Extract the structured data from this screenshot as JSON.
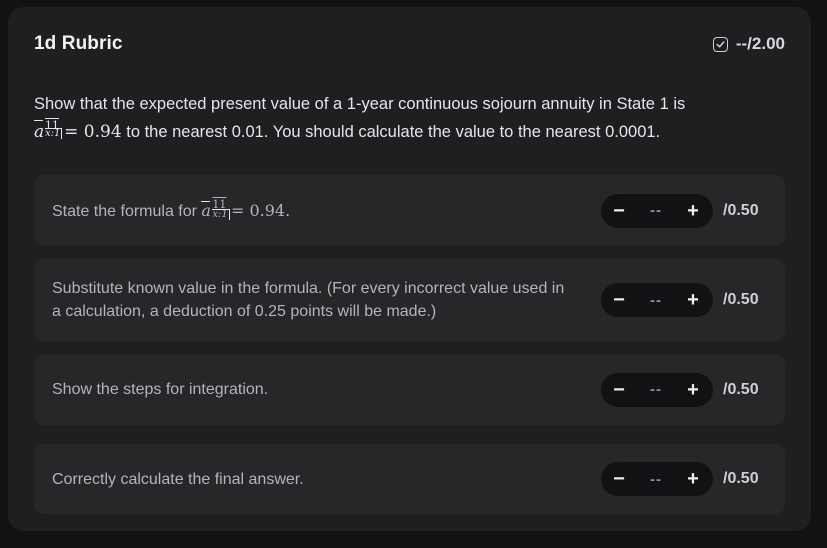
{
  "rubric": {
    "title": "1d Rubric",
    "score": "--/2.00",
    "question_text_before": "Show that the expected present value of a 1-year continuous sojourn annuity in State 1 is",
    "question_math_sup": "11",
    "question_math_sub": "x:1",
    "question_math_value": "= 0.94",
    "question_text_after": "to the nearest 0.01. You should calculate the value to the nearest 0.0001.",
    "items": [
      {
        "label": "State the formula for",
        "math_sup": "11",
        "math_sub": "x:1",
        "math_value": "= 0.94.",
        "value": "--",
        "max": "/0.50"
      },
      {
        "label": "Substitute known value in the formula. (For every incorrect value used in a calculation, a deduction of 0.25 points will be made.)",
        "value": "--",
        "max": "/0.50"
      },
      {
        "label": "Show the steps for integration.",
        "value": "--",
        "max": "/0.50"
      },
      {
        "label": "Correctly calculate the final answer.",
        "value": "--",
        "max": "/0.50"
      }
    ],
    "minus_label": "−",
    "plus_label": "+"
  }
}
